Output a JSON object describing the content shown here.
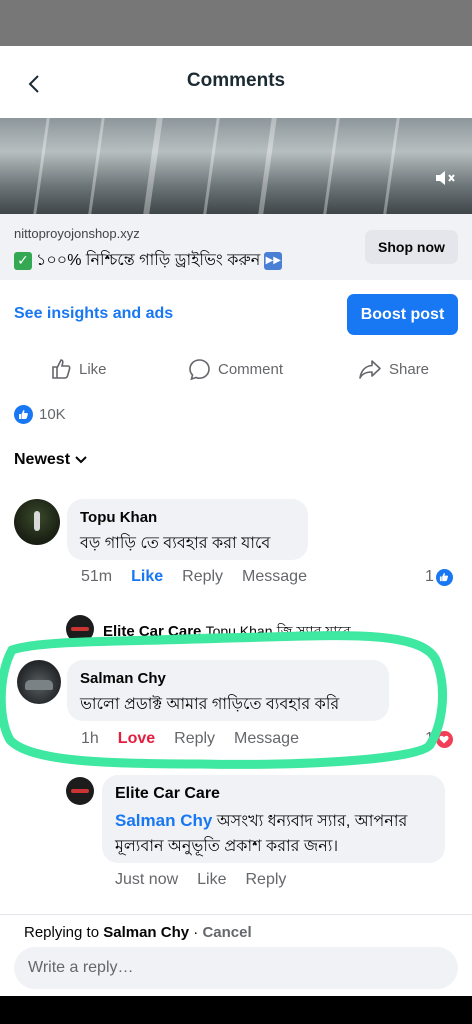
{
  "header": {
    "title": "Comments"
  },
  "ad": {
    "domain": "nittoproyojonshop.xyz",
    "headline": "১০০% নিশ্চিন্তে গাড়ি ড্রাইভিং করুন",
    "shop_button": "Shop now"
  },
  "post_actions": {
    "insights_link": "See insights and ads",
    "boost_button": "Boost post",
    "like": "Like",
    "comment": "Comment",
    "share": "Share"
  },
  "reactions_count": "10K",
  "sort_label": "Newest",
  "comments": [
    {
      "name": "Topu Khan",
      "text": "বড় গাড়ি তে ব্যবহার করা যাবে",
      "time": "51m",
      "reaction_label": "Like",
      "reply": "Reply",
      "message": "Message",
      "reaction_count": "1"
    },
    {
      "name": "Salman Chy",
      "text": "ভালো প্রডাক্ট আমার গাড়িতে ব্যবহার করি",
      "time": "1h",
      "reaction_label": "Love",
      "reply": "Reply",
      "message": "Message",
      "reaction_count": "1"
    }
  ],
  "collapsed_reply": {
    "name": "Elite Car Care",
    "mention": "Topu Khan",
    "text": "জ্বি স্যার যাবে"
  },
  "page_reply": {
    "name": "Elite Car Care",
    "mention": "Salman Chy",
    "text_line1": "অসংখ্য ধন্যবাদ স্যার, আপনার",
    "text_line2": "মূল্যবান অনুভূতি প্রকাশ করার জন্য।",
    "time": "Just now",
    "like": "Like",
    "reply": "Reply"
  },
  "reply_bar": {
    "prefix": "Replying to",
    "target": "Salman Chy",
    "separator": " · ",
    "cancel": "Cancel",
    "placeholder": "Write a reply…"
  },
  "colors": {
    "accent": "#1877f2",
    "love": "#e41e3f",
    "highlight": "#3ee8a0"
  }
}
